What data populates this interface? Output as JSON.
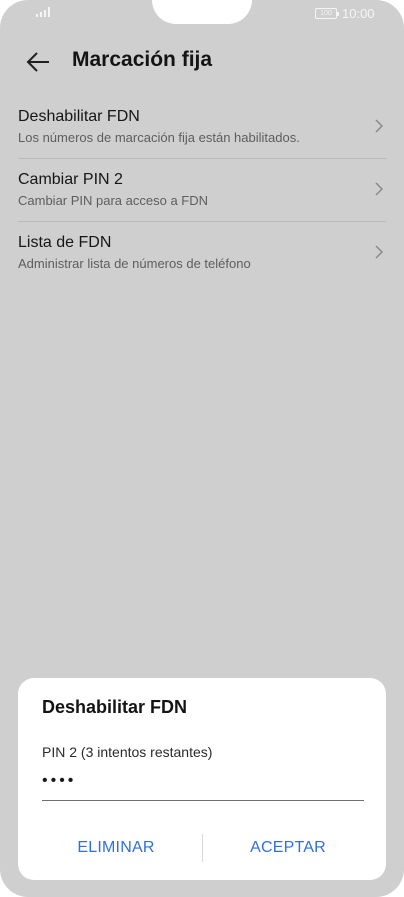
{
  "status_bar": {
    "battery": "100",
    "time": "10:00",
    "signal_icon": "signal-icon",
    "battery_icon": "battery-icon"
  },
  "app_bar": {
    "title": "Marcación fija",
    "back_icon": "arrow-left-icon"
  },
  "settings": {
    "items": [
      {
        "title": "Deshabilitar FDN",
        "subtitle": "Los números de marcación fija están habilitados.",
        "icon": "chevron-right-icon"
      },
      {
        "title": "Cambiar PIN 2",
        "subtitle": "Cambiar PIN para acceso a FDN",
        "icon": "chevron-right-icon"
      },
      {
        "title": "Lista de FDN",
        "subtitle": "Administrar lista de números de teléfono",
        "icon": "chevron-right-icon"
      }
    ]
  },
  "dialog": {
    "title": "Deshabilitar FDN",
    "pin_label": "PIN 2 (3 intentos restantes)",
    "pin_value": "••••",
    "buttons": {
      "cancel": "ELIMINAR",
      "ok": "ACEPTAR"
    }
  },
  "colors": {
    "scrim": "#cfcfcf",
    "accent": "#2f6fe3",
    "surface": "#ffffff"
  }
}
